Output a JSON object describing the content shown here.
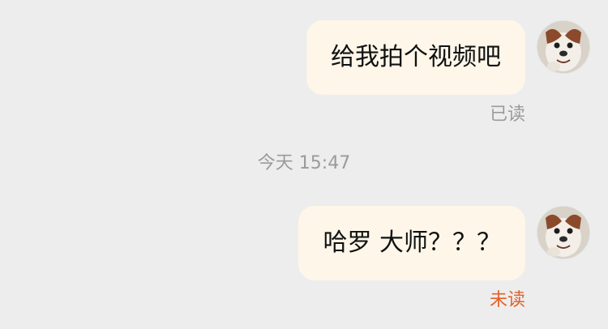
{
  "conversation": {
    "messages": [
      {
        "text": "给我拍个视频吧",
        "status": "已读",
        "status_color": "#9b9b9b"
      },
      {
        "text": "哈罗 大师？？？",
        "status": "未读",
        "status_color": "#e0622b"
      }
    ],
    "timestamp": "今天 15:47"
  },
  "colors": {
    "background": "#ededed",
    "bubble": "#fdf6e9",
    "read": "#9b9b9b",
    "unread": "#e0622b"
  },
  "avatar": {
    "icon": "dog-avatar-icon"
  }
}
